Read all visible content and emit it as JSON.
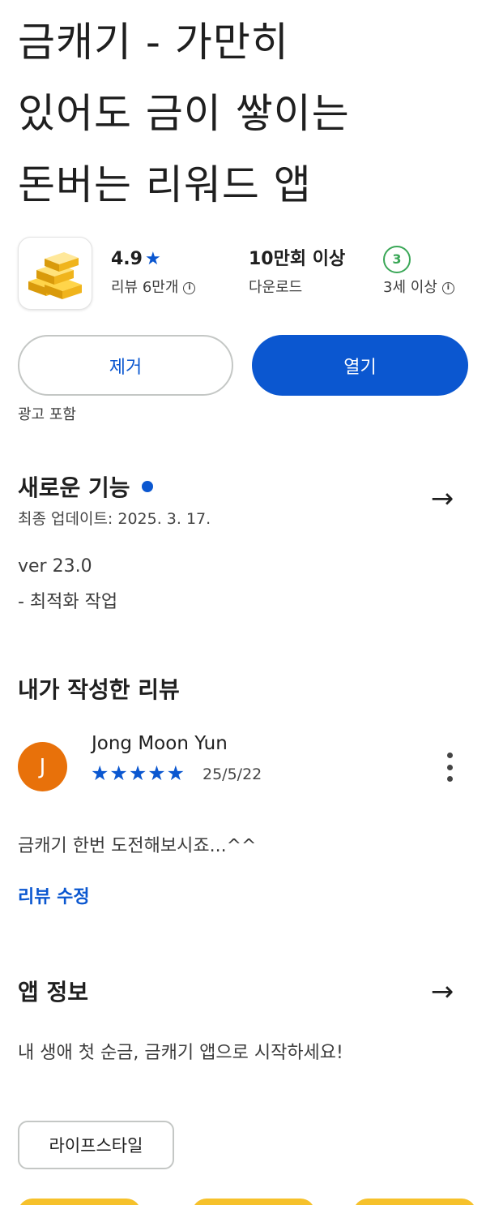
{
  "app": {
    "title_lines": [
      "금캐기 - 가만히",
      "있어도 금이 쌓이는",
      "돈버는 리워드 앱"
    ],
    "icon": "gold-bars-icon"
  },
  "stats": {
    "rating": "4.9",
    "rating_icon": "star-icon",
    "reviews_label": "리뷰 6만개",
    "downloads": "10만회 이상",
    "downloads_label": "다운로드",
    "age_badge": "3",
    "age_label": "3세 이상"
  },
  "actions": {
    "remove_label": "제거",
    "open_label": "열기",
    "ads_note": "광고 포함"
  },
  "whats_new": {
    "title": "새로운 기능",
    "updated": "최종 업데이트: 2025. 3. 17.",
    "version": "ver 23.0",
    "note": "- 최적화 작업"
  },
  "my_review": {
    "title": "내가 작성한 리뷰",
    "avatar_letter": "J",
    "author": "Jong Moon Yun",
    "stars": "★★★★★",
    "rating": 5,
    "date": "25/5/22",
    "text": "금캐기 한번 도전해보시죠...^^",
    "edit_label": "리뷰 수정"
  },
  "about": {
    "title": "앱 정보",
    "description": "내 생애 첫 순금, 금캐기 앱으로 시작하세요!",
    "category_chip": "라이프스타일"
  },
  "colors": {
    "accent": "#0b57d0",
    "avatar": "#e8710a",
    "age_green": "#3aa757",
    "gold": "#f6c12b"
  }
}
